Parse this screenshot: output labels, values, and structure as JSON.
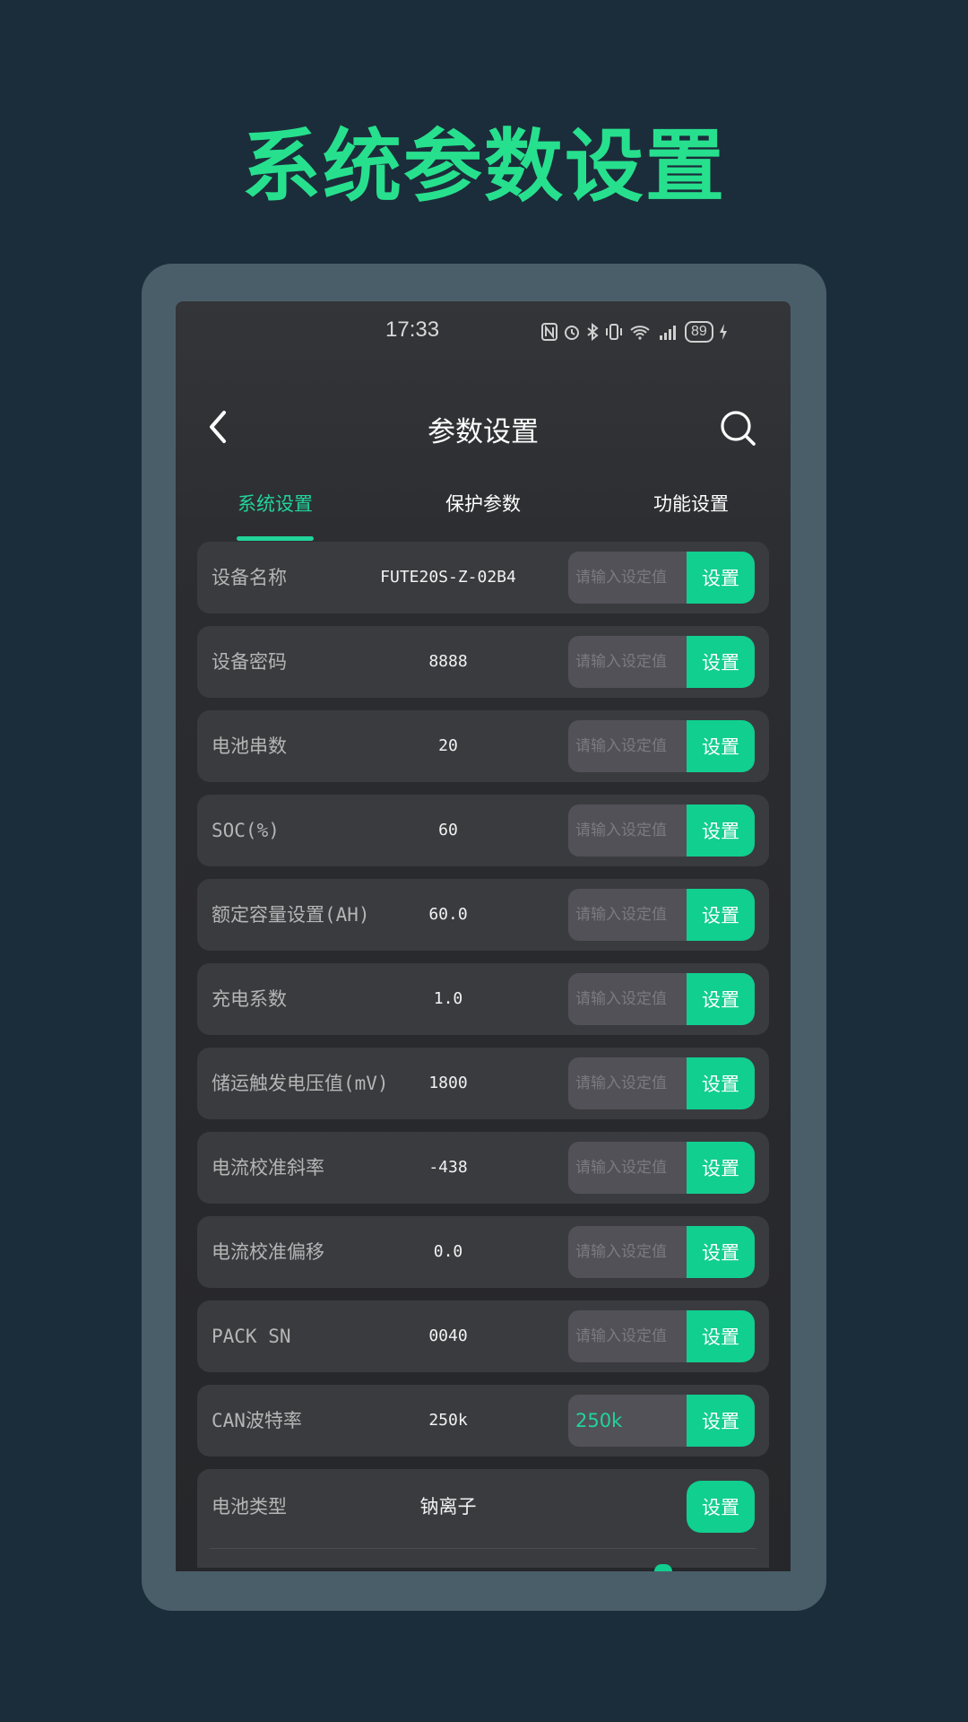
{
  "hero": {
    "title": "系统参数设置"
  },
  "status_bar": {
    "time": "17:33",
    "battery": "89"
  },
  "header": {
    "title": "参数设置"
  },
  "tabs": [
    {
      "label": "系统设置",
      "active": true
    },
    {
      "label": "保护参数",
      "active": false
    },
    {
      "label": "功能设置",
      "active": false
    }
  ],
  "rows": [
    {
      "label": "设备名称",
      "value": "FUTE20S-Z-02B4",
      "placeholder": "请输入设定值",
      "input_value": "",
      "button": "设置"
    },
    {
      "label": "设备密码",
      "value": "8888",
      "placeholder": "请输入设定值",
      "input_value": "",
      "button": "设置"
    },
    {
      "label": "电池串数",
      "value": "20",
      "placeholder": "请输入设定值",
      "input_value": "",
      "button": "设置"
    },
    {
      "label": "SOC(%)",
      "value": "60",
      "placeholder": "请输入设定值",
      "input_value": "",
      "button": "设置"
    },
    {
      "label": "额定容量设置(AH)",
      "value": "60.0",
      "placeholder": "请输入设定值",
      "input_value": "",
      "button": "设置"
    },
    {
      "label": "充电系数",
      "value": "1.0",
      "placeholder": "请输入设定值",
      "input_value": "",
      "button": "设置"
    },
    {
      "label": "储运触发电压值(mV)",
      "value": "1800",
      "placeholder": "请输入设定值",
      "input_value": "",
      "button": "设置"
    },
    {
      "label": "电流校准斜率",
      "value": "-438",
      "placeholder": "请输入设定值",
      "input_value": "",
      "button": "设置"
    },
    {
      "label": "电流校准偏移",
      "value": "0.0",
      "placeholder": "请输入设定值",
      "input_value": "",
      "button": "设置"
    },
    {
      "label": "PACK SN",
      "value": "0040",
      "placeholder": "请输入设定值",
      "input_value": "",
      "button": "设置"
    },
    {
      "label": "CAN波特率",
      "value": "250k",
      "placeholder": "",
      "input_value": "250k",
      "button": "设置"
    }
  ],
  "battery_type_row": {
    "label": "电池类型",
    "value": "钠离子",
    "button": "设置"
  },
  "colors": {
    "accent": "#22d49a",
    "button": "#10cf8f",
    "background": "#1b2d3a",
    "frame": "#4a5e6a",
    "hero": "#27e08e"
  }
}
